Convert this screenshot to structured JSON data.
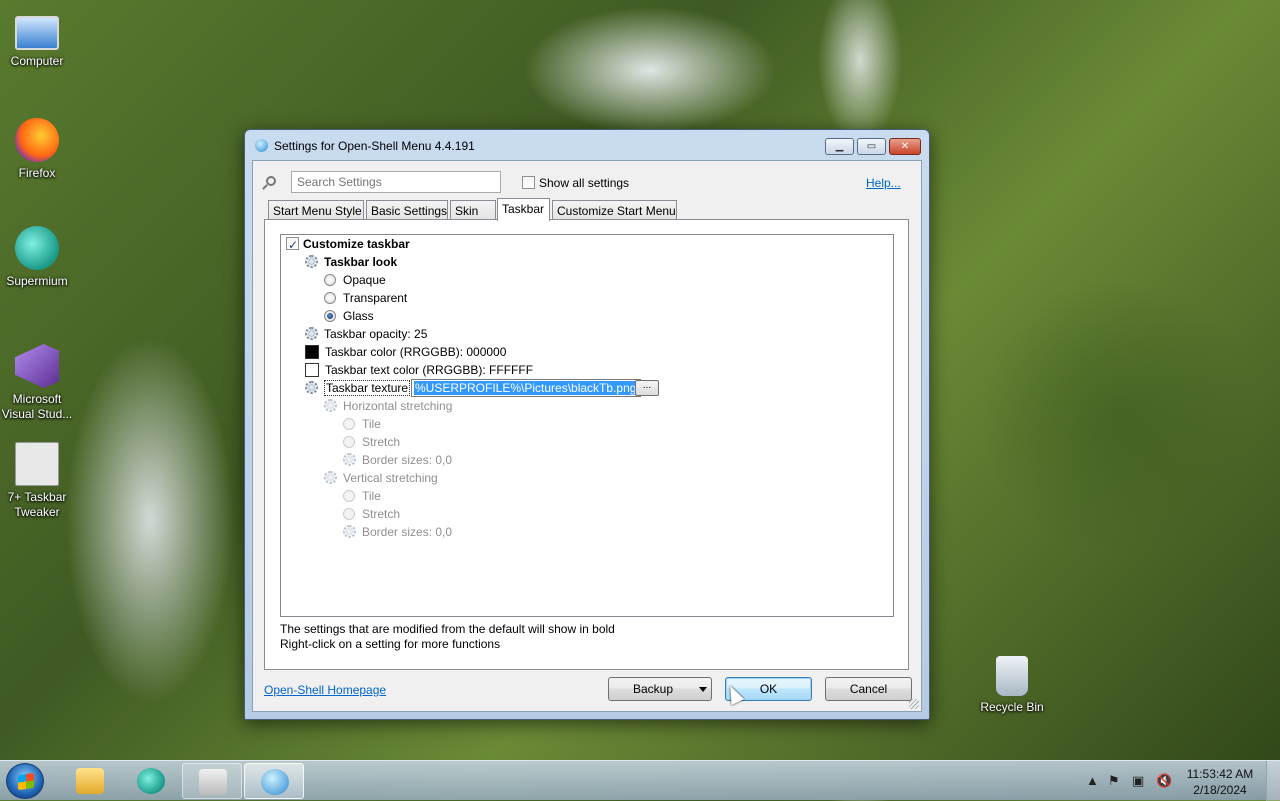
{
  "desktop": {
    "icons": [
      {
        "label": "Computer",
        "icon": "computer-icon"
      },
      {
        "label": "Firefox",
        "icon": "firefox-icon"
      },
      {
        "label": "Supermium",
        "icon": "supermium-icon"
      },
      {
        "label": "Microsoft Visual Stud...",
        "icon": "visual-studio-icon"
      },
      {
        "label": "7+ Taskbar Tweaker",
        "icon": "tweaker-icon"
      },
      {
        "label": "Recycle Bin",
        "icon": "recycle-bin-icon"
      }
    ]
  },
  "dialog": {
    "title": "Settings for Open-Shell Menu 4.4.191",
    "search_placeholder": "Search Settings",
    "show_all_label": "Show all settings",
    "help_label": "Help...",
    "tabs": [
      {
        "label": "Start Menu Style"
      },
      {
        "label": "Basic Settings"
      },
      {
        "label": "Skin"
      },
      {
        "label": "Taskbar",
        "active": true
      },
      {
        "label": "Customize Start Menu"
      }
    ],
    "tree": {
      "customize_taskbar": "Customize taskbar",
      "taskbar_look": "Taskbar look",
      "opaque": "Opaque",
      "transparent": "Transparent",
      "glass": "Glass",
      "opacity": "Taskbar opacity: 25",
      "color": "Taskbar color (RRGGBB): 000000",
      "text_color": "Taskbar text color (RRGGBB): FFFFFF",
      "texture_label": "Taskbar texture",
      "texture_value": "%USERPROFILE%\\Pictures\\blackTb.png",
      "browse": "...",
      "h_stretch": "Horizontal stretching",
      "h_tile": "Tile",
      "h_stretch_opt": "Stretch",
      "h_border": "Border sizes: 0,0",
      "v_stretch": "Vertical stretching",
      "v_tile": "Tile",
      "v_stretch_opt": "Stretch",
      "v_border": "Border sizes: 0,0",
      "color_swatch": "#000000",
      "text_color_swatch": "#FFFFFF"
    },
    "info_line1": "The settings that are modified from the default will show in bold",
    "info_line2": "Right-click on a setting for more functions",
    "homepage_label": "Open-Shell Homepage",
    "backup_label": "Backup",
    "ok_label": "OK",
    "cancel_label": "Cancel"
  },
  "taskbar": {
    "clock_time": "11:53:42 AM",
    "clock_date": "2/18/2024",
    "apps": [
      {
        "icon": "file-explorer-icon"
      },
      {
        "icon": "supermium-icon"
      },
      {
        "icon": "tweaker-icon"
      },
      {
        "icon": "open-shell-icon"
      }
    ]
  }
}
